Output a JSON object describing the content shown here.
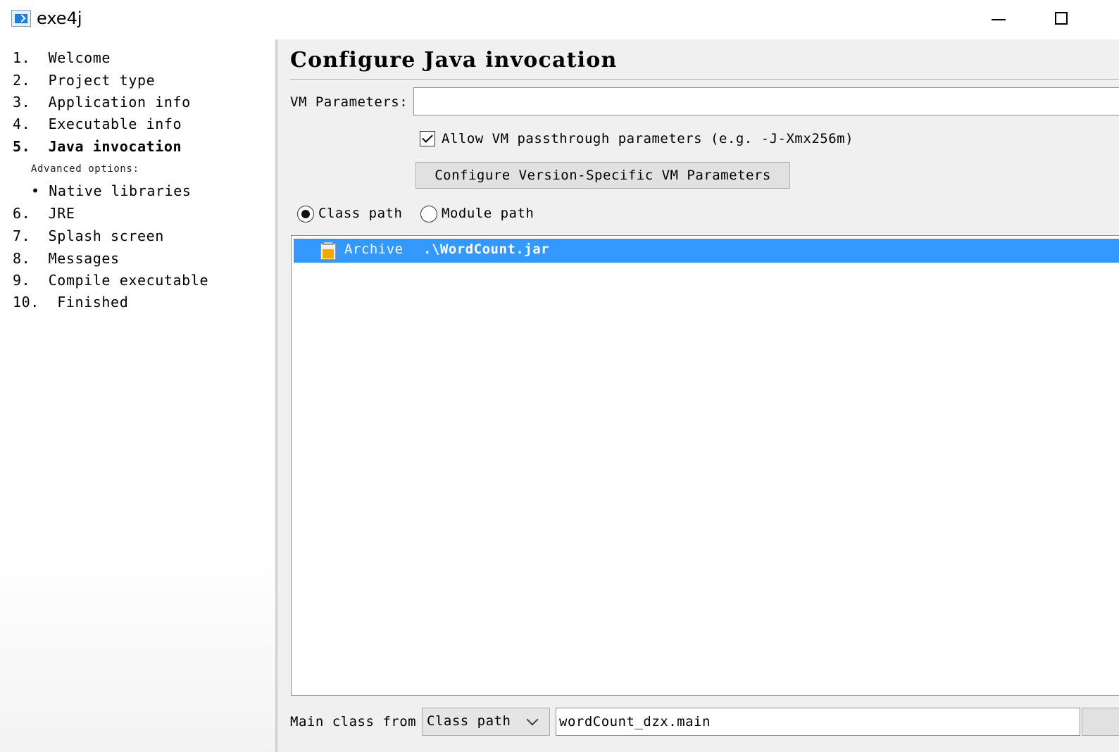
{
  "window": {
    "title": "exe4j",
    "icon": "exe4j-app-icon",
    "controls": [
      "minimize-icon",
      "maximize-icon"
    ]
  },
  "nav": {
    "items": [
      {
        "label": "1.  Welcome",
        "active": false
      },
      {
        "label": "2.  Project type",
        "active": false
      },
      {
        "label": "3.  Application info",
        "active": false
      },
      {
        "label": "4.  Executable info",
        "active": false
      },
      {
        "label": "5.  Java invocation",
        "active": true
      },
      {
        "label": "6.  JRE",
        "active": false
      },
      {
        "label": "7.  Splash screen",
        "active": false
      },
      {
        "label": "8.  Messages",
        "active": false
      },
      {
        "label": "9.  Compile executable",
        "active": false
      },
      {
        "label": "10.  Finished",
        "active": false
      }
    ],
    "advanced_heading": "Advanced options:",
    "advanced_items": [
      "• Native libraries"
    ]
  },
  "main": {
    "title": "Configure Java invocation",
    "vm_parameters_label": "VM Parameters:",
    "vm_parameters_value": "",
    "allow_passthrough": {
      "label": "Allow VM passthrough parameters (e.g. -J-Xmx256m)",
      "checked": true
    },
    "version_specific_button": "Configure Version-Specific VM Parameters",
    "path_mode": {
      "options": [
        "Class path",
        "Module path"
      ],
      "selected": "Class path"
    },
    "classpath_entries": [
      {
        "kind": "Archive",
        "path": ".\\WordCount.jar",
        "icon": "jar-archive-icon",
        "selected": true
      }
    ],
    "main_class": {
      "label": "Main class from",
      "source": "Class path",
      "value": "wordCount_dzx.main"
    }
  },
  "colors": {
    "selection": "#3399ff",
    "panel_background": "#f0f0f0",
    "button_background": "#e1e1e1"
  }
}
